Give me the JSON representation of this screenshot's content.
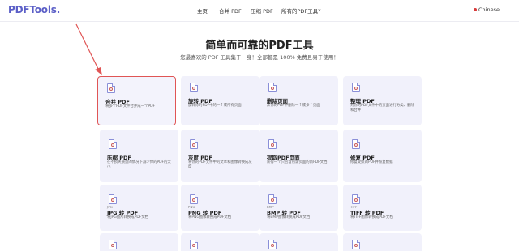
{
  "header": {
    "logo": "PDFTools",
    "logo_dot": ".",
    "nav": [
      "主页",
      "合并 PDF",
      "压缩 PDF",
      "所有的PDF工具"
    ],
    "language": "Chinese"
  },
  "hero": {
    "title": "简单而可靠的PDF工具",
    "subtitle": "您最喜欢的 PDF 工具集于一身！全部都是 100% 免费且易于使用！"
  },
  "cards": [
    {
      "title": "合并 PDF",
      "desc": "将多个PDF文件合并成一个PDF",
      "tag": ""
    },
    {
      "title": "旋转 PDF",
      "desc": "旋转你的PDF中的一个或所有页面",
      "tag": ""
    },
    {
      "title": "删除页面",
      "desc": "从你的PDF中删除一个或多个页面",
      "tag": ""
    },
    {
      "title": "整理 PDF",
      "desc": "对你的PDF文件中的页面进行分类、删除和合并",
      "tag": ""
    },
    {
      "title": "压缩 PDF",
      "desc": "在不损失质量的情况下减少你的PDF的大小",
      "tag": ""
    },
    {
      "title": "灰度 PDF",
      "desc": "将你的PDF文件中的文本和图像转换成灰度",
      "tag": ""
    },
    {
      "title": "提取PDF页面",
      "desc": "获得一个只包含所需页面的新PDF文档",
      "tag": ""
    },
    {
      "title": "修复 PDF",
      "desc": "修复受损的PDF并恢复数据",
      "tag": ""
    },
    {
      "title": "JPG 转 PDF",
      "desc": "将JPG图片转换成PDF文档",
      "tag": "JPG"
    },
    {
      "title": "PNG 转 PDF",
      "desc": "将PNG图像转换成PDF文档",
      "tag": "PNG"
    },
    {
      "title": "BMP 转 PDF",
      "desc": "将BMP图像转换成PDF文档",
      "tag": "BMP"
    },
    {
      "title": "TIFF 转 PDF",
      "desc": "将TIFF图像转换成PDF文档",
      "tag": "TIFF"
    }
  ],
  "colors": {
    "accent": "#5b5fc7",
    "card_bg": "#f1f1fb",
    "selection": "#e05555"
  }
}
